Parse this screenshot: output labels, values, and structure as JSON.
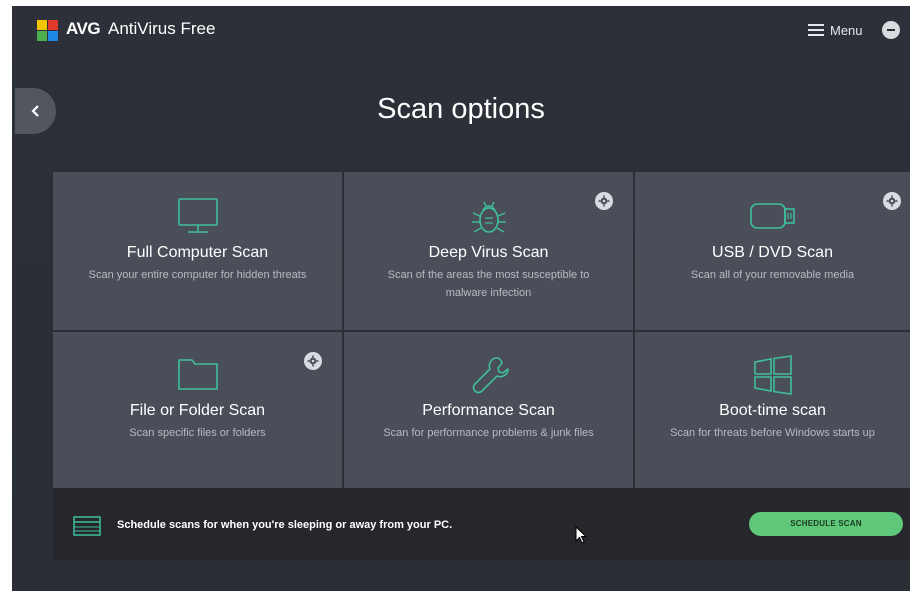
{
  "app": {
    "brand": "AVG",
    "product": "AntiVirus Free",
    "menu_label": "Menu"
  },
  "page": {
    "title": "Scan options"
  },
  "scans": [
    {
      "name": "Full Computer Scan",
      "description": "Scan your entire computer for hidden threats",
      "icon": "monitor-icon",
      "has_settings": false
    },
    {
      "name": "Deep Virus Scan",
      "description": "Scan of the areas the most susceptible to malware infection",
      "icon": "bug-icon",
      "has_settings": true
    },
    {
      "name": "USB / DVD Scan",
      "description": "Scan all of your removable media",
      "icon": "usb-drive-icon",
      "has_settings": true
    },
    {
      "name": "File or Folder Scan",
      "description": "Scan specific files or folders",
      "icon": "folder-icon",
      "has_settings": true
    },
    {
      "name": "Performance Scan",
      "description": "Scan for performance problems & junk files",
      "icon": "wrench-icon",
      "has_settings": false
    },
    {
      "name": "Boot-time scan",
      "description": "Scan for threats before Windows starts up",
      "icon": "windows-icon",
      "has_settings": false
    }
  ],
  "schedule": {
    "text": "Schedule scans for when you're sleeping or away from your PC.",
    "button_label": "SCHEDULE SCAN",
    "icon": "calendar-icon"
  },
  "colors": {
    "background": "#2b2e36",
    "tile": "#4a4e58",
    "accent_green": "#5fc878",
    "icon_teal": "#3fbf9b"
  }
}
